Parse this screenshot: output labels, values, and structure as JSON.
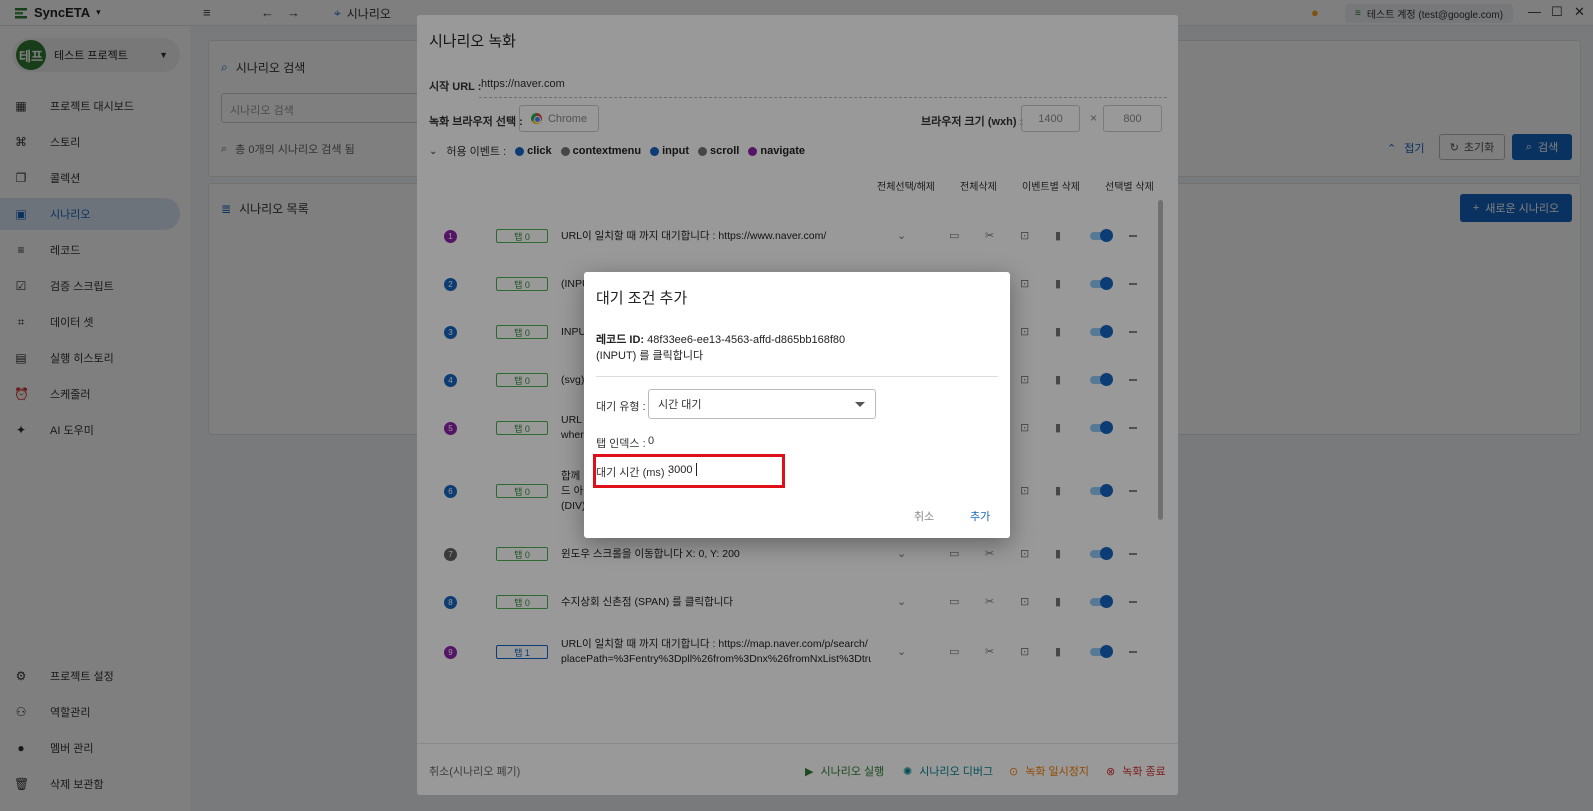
{
  "app": {
    "brand": "SyncETA",
    "location_label": "시나리오",
    "account": "테스트 계정 (test@google.com)",
    "project_avatar": "테프",
    "project_name": "테스트 프로젝트"
  },
  "sidebar": {
    "items": [
      {
        "label": "프로젝트 대시보드",
        "icon": "dashboard-icon"
      },
      {
        "label": "스토리",
        "icon": "story-icon"
      },
      {
        "label": "콜렉션",
        "icon": "collection-icon"
      },
      {
        "label": "시나리오",
        "icon": "scenario-icon"
      },
      {
        "label": "레코드",
        "icon": "record-icon"
      },
      {
        "label": "검증 스크립트",
        "icon": "checklist-icon"
      },
      {
        "label": "데이터 셋",
        "icon": "dataset-icon"
      },
      {
        "label": "실행 히스토리",
        "icon": "history-icon"
      },
      {
        "label": "스케줄러",
        "icon": "alarm-icon"
      },
      {
        "label": "AI 도우미",
        "icon": "sparkle-icon"
      }
    ],
    "bottom_items": [
      {
        "label": "프로젝트 설정",
        "icon": "gear-icon"
      },
      {
        "label": "역할관리",
        "icon": "role-icon"
      },
      {
        "label": "멤버 관리",
        "icon": "person-icon"
      },
      {
        "label": "삭제 보관함",
        "icon": "trash-icon"
      }
    ]
  },
  "search_panel": {
    "title": "시나리오 검색",
    "placeholder": "시나리오 검색",
    "count_text": "총 0개의 시나리오 검색 됨",
    "collapse_label": "접기",
    "reset_label": "초기화",
    "search_label": "검색"
  },
  "list_panel": {
    "title": "시나리오 목록",
    "new_label": "새로운 시나리오"
  },
  "recording": {
    "title": "시나리오 녹화",
    "start_url_label": "시작 URL :",
    "start_url": "https://naver.com",
    "browser_label": "녹화 브라우저 선택 :",
    "browser": "Chrome",
    "size_label": "브라우저 크기 (wxh) :",
    "width": "1400",
    "height": "800",
    "size_sep": "×",
    "events_label": "허용 이벤트 :",
    "events": [
      {
        "name": "click",
        "color": "#1565c0"
      },
      {
        "name": "contextmenu",
        "color": "#757575"
      },
      {
        "name": "input",
        "color": "#1565c0"
      },
      {
        "name": "scroll",
        "color": "#757575"
      },
      {
        "name": "navigate",
        "color": "#8e24aa"
      }
    ],
    "columns": {
      "select_all": "전체선택/해제",
      "delete_all": "전체삭제",
      "delete_by_event": "이벤트별 삭제",
      "delete_selected": "선택별 삭제"
    },
    "steps": [
      {
        "num": "1",
        "color": "#8e24aa",
        "tab": "탭 0",
        "lines": [
          "URL이 일치할 때 까지 대기합니다 : https://www.naver.com/"
        ]
      },
      {
        "num": "2",
        "color": "#1565c0",
        "tab": "탭 0",
        "lines": [
          "(INPUT) 를 클릭합니다"
        ]
      },
      {
        "num": "3",
        "color": "#1565c0",
        "tab": "탭 0",
        "lines": [
          "INPU"
        ]
      },
      {
        "num": "4",
        "color": "#1565c0",
        "tab": "탭 0",
        "lines": [
          "(svg)"
        ]
      },
      {
        "num": "5",
        "color": "#8e24aa",
        "tab": "탭 0",
        "lines": [
          "URL",
          "wher"
        ]
      },
      {
        "num": "6",
        "color": "#1565c0",
        "tab": "탭 0",
        "lines": [
          "합께",
          "드 아",
          "(DIV)"
        ]
      },
      {
        "num": "7",
        "color": "#616161",
        "tab": "탭 0",
        "lines": [
          "윈도우 스크롤을 이동합니다 X: 0, Y: 200"
        ]
      },
      {
        "num": "8",
        "color": "#1565c0",
        "tab": "탭 0",
        "lines": [
          "수지상회 신촌점 (SPAN) 를 클릭합니다"
        ]
      },
      {
        "num": "9",
        "color": "#8e24aa",
        "tab": "탭 1",
        "lines": [
          "URL이 일치할 때 까지 대기합니다 : https://map.naver.com/p/search/",
          "placePath=%3Fentry%3Dpll%26from%3Dnx%26fromNxList%3Dtru"
        ]
      }
    ],
    "footer": {
      "cancel": "취소(시나리오 폐기)",
      "run": "시나리오 실행",
      "debug": "시나리오 디버그",
      "pause": "녹화 일시정지",
      "stop": "녹화 종료"
    }
  },
  "wait_modal": {
    "title": "대기 조건 추가",
    "record_id_label": "레코드 ID:",
    "record_id": "48f33ee6-ee13-4563-affd-d865bb168f80",
    "record_desc": "(INPUT) 를 클릭합니다",
    "wait_type_label": "대기 유형 :",
    "wait_type": "시간 대기",
    "tab_index_label": "탭 인덱스 :",
    "tab_index": "0",
    "wait_ms_label": "대기 시간 (ms) :",
    "wait_ms": "3000",
    "cancel": "취소",
    "add": "추가"
  }
}
